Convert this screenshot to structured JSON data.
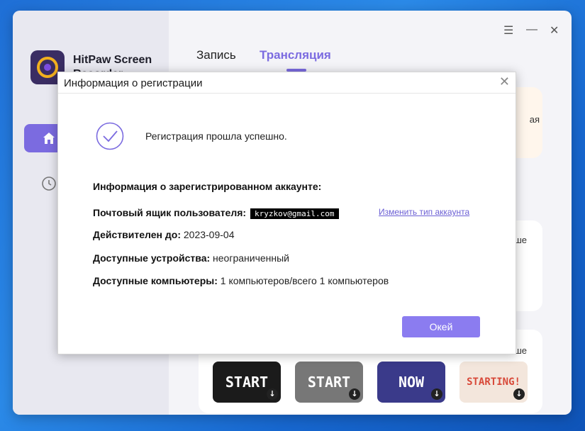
{
  "app": {
    "name": "HitPaw Screen Recorder",
    "colors": {
      "accent": "#7b6be0",
      "button": "#8b7cf0",
      "logo_bg": "#3a2d63",
      "logo_ring": "#f2b01e"
    }
  },
  "sidebar": {
    "items": [
      {
        "name": "home",
        "icon": "home-icon"
      },
      {
        "name": "history",
        "icon": "clock-icon"
      }
    ]
  },
  "window_controls": [
    "menu-icon",
    "minimize-icon",
    "close-icon"
  ],
  "tabs": [
    {
      "label": "Запись",
      "active": false
    },
    {
      "label": "Трансляция",
      "active": true
    }
  ],
  "background_peek": {
    "card1_text": "ая",
    "card2_text": "ше",
    "card3_text": "ше"
  },
  "thumbnails": [
    {
      "label": "START",
      "bg": "#1b1b1b",
      "fg": "#ffffff"
    },
    {
      "label": "START",
      "bg": "#777777",
      "fg": "#ffffff"
    },
    {
      "label": "NOW",
      "bg": "#3a3a8a",
      "fg": "#ffffff"
    },
    {
      "label": "STARTING!",
      "bg": "#f3e6dc",
      "fg": "#d84a3a"
    }
  ],
  "dialog": {
    "title": "Информация о регистрации",
    "success_message": "Регистрация прошла успешно.",
    "info_heading": "Информация о зарегистрированном аккаунте:",
    "email_label": "Почтовый ящик пользователя:",
    "email_value": "kryzkov@gmail.com",
    "change_link": "Изменить тип аккаунта",
    "valid_until_label": "Действителен до:",
    "valid_until_value": "2023-09-04",
    "devices_label": "Доступные устройства:",
    "devices_value": "неограниченный",
    "computers_label": "Доступные компьютеры:",
    "computers_value": "1 компьютеров/всего 1 компьютеров",
    "ok_label": "Окей"
  }
}
